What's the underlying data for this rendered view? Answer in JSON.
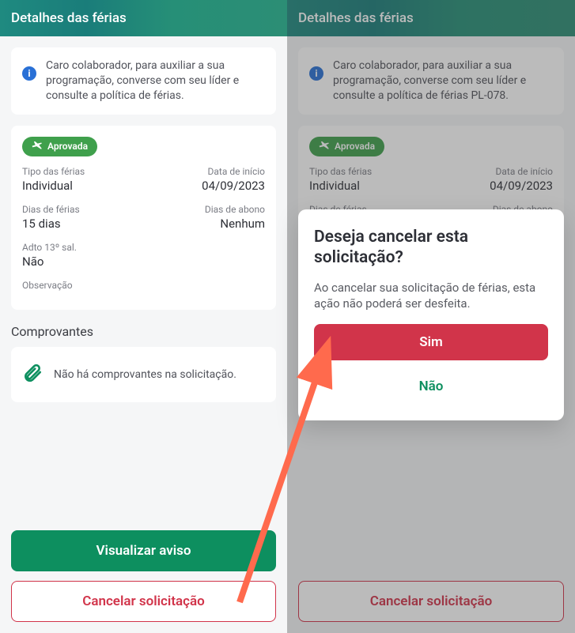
{
  "left": {
    "header_title": "Detalhes das férias",
    "notice_text": "Caro colaborador, para auxiliar a sua programação, converse com seu líder e consulte a política de férias.",
    "badge_label": "Aprovada",
    "fields": {
      "tipo_label": "Tipo das férias",
      "tipo_value": "Individual",
      "inicio_label": "Data de início",
      "inicio_value": "04/09/2023",
      "dias_label": "Dias de férias",
      "dias_value": "15 dias",
      "abono_label": "Dias de abono",
      "abono_value": "Nenhum",
      "adto_label": "Adto 13º sal.",
      "adto_value": "Não",
      "obs_label": "Observação"
    },
    "section_comprovantes": "Comprovantes",
    "attachment_empty": "Não há comprovantes na solicitação.",
    "btn_view": "Visualizar aviso",
    "btn_cancel": "Cancelar solicitação"
  },
  "right": {
    "header_title": "Detalhes das férias",
    "notice_text": "Caro colaborador, para auxiliar a sua programação, converse com seu líder e consulte a política de férias PL-078.",
    "badge_label": "Aprovada",
    "fields": {
      "tipo_label": "Tipo das férias",
      "tipo_value": "Individual",
      "inicio_label": "Data de início",
      "inicio_value": "04/09/2023",
      "dias_label": "Dias de férias",
      "abono_label": "Dias de abono"
    },
    "btn_cancel": "Cancelar solicitação",
    "modal": {
      "title": "Deseja cancelar esta solicitação?",
      "desc": "Ao cancelar sua solicitação de férias, esta ação não poderá ser desfeita.",
      "yes": "Sim",
      "no": "Não"
    }
  },
  "colors": {
    "accent_green": "#0d8f5f",
    "danger_red": "#d1344a",
    "badge_green": "#3fa04c",
    "info_blue": "#2970d6"
  }
}
